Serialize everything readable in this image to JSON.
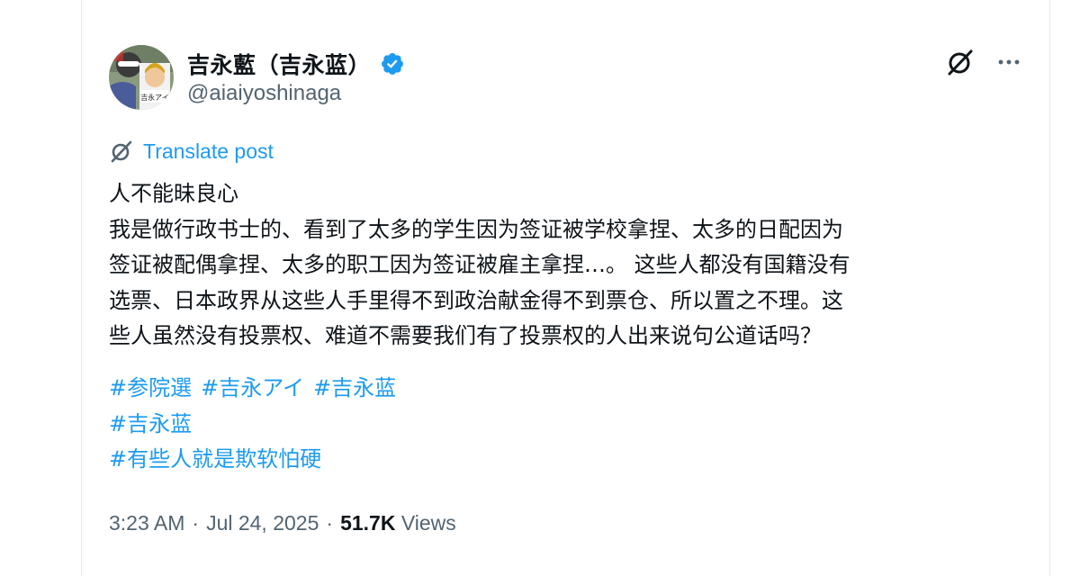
{
  "author": {
    "display_name": "吉永藍（吉永蓝）",
    "handle": "@aiaiyoshinaga",
    "avatar_label": "吉永アイ",
    "verified": true
  },
  "actions": {
    "grok_icon": "grok-slash-icon",
    "more_icon": "more-dots-icon"
  },
  "translate": {
    "label": "Translate post"
  },
  "post": {
    "lines": [
      "人不能昧良心",
      "我是做行政书士的、看到了太多的学生因为签证被学校拿捏、太多的日配因为",
      "签证被配偶拿捏、太多的职工因为签证被雇主拿捏…。 这些人都没有国籍没有",
      "选票、日本政界从这些人手里得不到政治献金得不到票仓、所以置之不理。这",
      "些人虽然没有投票权、难道不需要我们有了投票权的人出来说句公道话吗？"
    ],
    "hashtag_lines": [
      [
        "#参院選",
        "#吉永アイ",
        "#吉永蓝"
      ],
      [
        "#吉永蓝"
      ],
      [
        "#有些人就是欺软怕硬"
      ]
    ]
  },
  "meta": {
    "time": "3:23 AM",
    "sep1": "·",
    "date": "Jul 24, 2025",
    "sep2": "·",
    "views_count": "51.7K",
    "views_label": "Views"
  },
  "colors": {
    "link": "#1d9bf0",
    "text": "#0f1419",
    "muted": "#536471",
    "verified": "#1d9bf0"
  }
}
